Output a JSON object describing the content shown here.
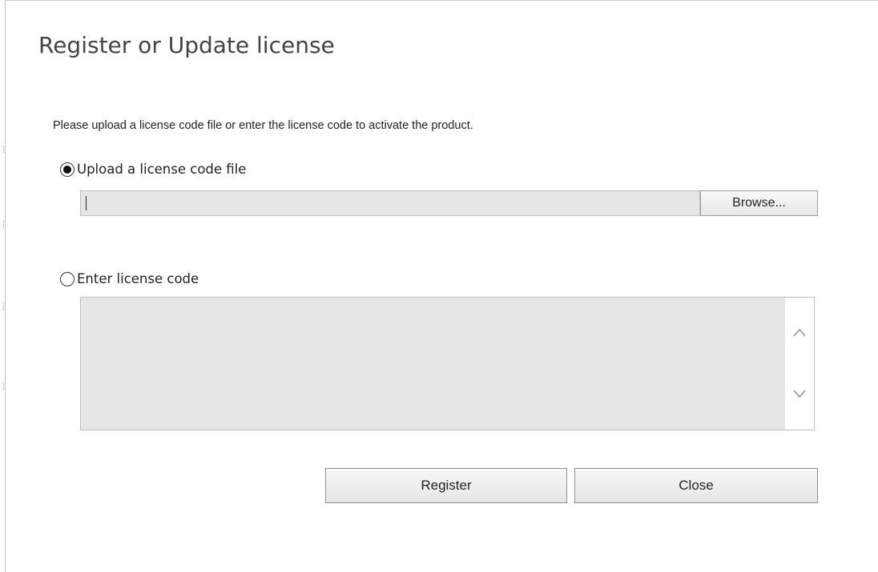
{
  "dialog": {
    "title": "Register or Update license",
    "instructions": "Please upload a license code file or enter the license code to activate the product."
  },
  "upload_option": {
    "label": "Upload a license code file",
    "selected": true,
    "file_path": "",
    "browse_label": "Browse..."
  },
  "code_option": {
    "label": "Enter license code",
    "selected": false,
    "code_value": ""
  },
  "actions": {
    "register_label": "Register",
    "close_label": "Close"
  },
  "icons": {
    "scroll_up": "chevron-up-icon",
    "scroll_down": "chevron-down-icon"
  },
  "colors": {
    "field_background": "#e6e6e6",
    "field_border": "#bdbdbd",
    "title_text": "#444444"
  }
}
